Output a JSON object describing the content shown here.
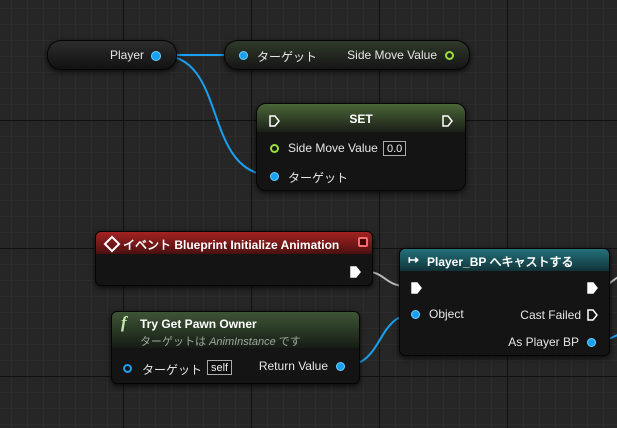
{
  "player_node": {
    "label": "Player"
  },
  "get_node": {
    "target_label": "ターゲット",
    "output_label": "Side Move Value"
  },
  "set_node": {
    "title": "SET",
    "side_move_label": "Side Move Value",
    "side_move_value": "0.0",
    "target_label": "ターゲット"
  },
  "event_node": {
    "title": "イベント Blueprint Initialize Animation"
  },
  "pawn_node": {
    "title": "Try Get Pawn Owner",
    "subtitle_prefix": "ターゲットは ",
    "subtitle_class": "AnimInstance",
    "subtitle_suffix": " です",
    "target_label": "ターゲット",
    "target_value": "self",
    "return_label": "Return Value"
  },
  "cast_node": {
    "title": "Player_BP へキャストする",
    "object_label": "Object",
    "cast_failed_label": "Cast Failed",
    "as_player_label": "As Player BP"
  },
  "colors": {
    "object_pin": "#1aa0f0",
    "float_pin": "#9adf3c",
    "event_header": "#8e1a1a",
    "cast_header": "#1c5a63",
    "function_header": "#33452e",
    "variable_header": "#3f5530"
  },
  "icons": {
    "event": "diamond-icon",
    "function": "function-f-icon",
    "cast": "cast-arrow-icon"
  }
}
